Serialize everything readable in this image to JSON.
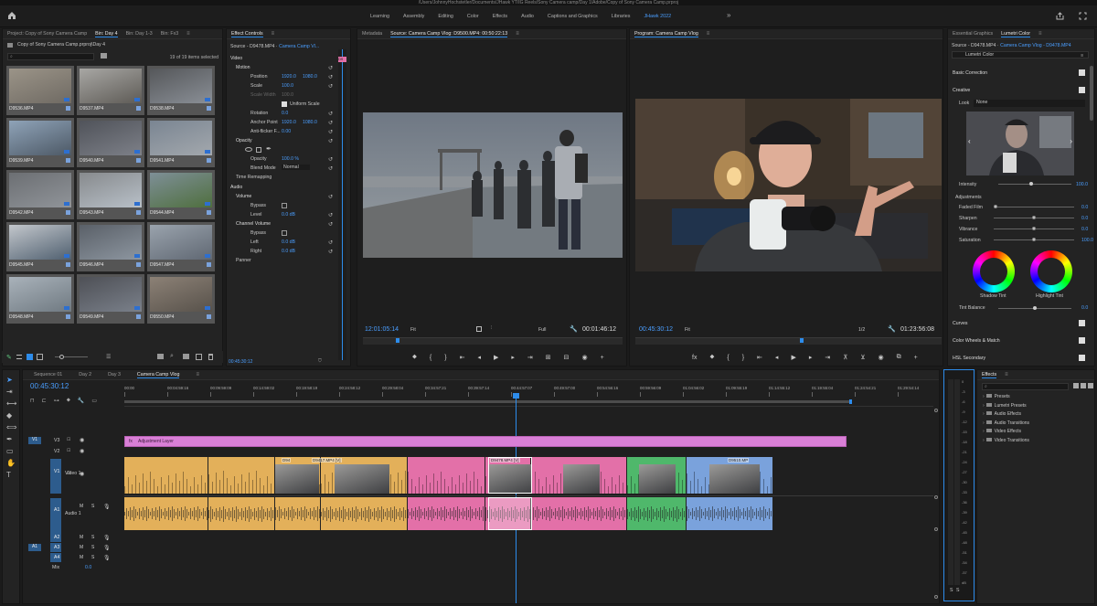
{
  "title_bar": {
    "path": "/Users/JohnnyHochstetler/Documents/JHawk YT/IG Reels/Sony Camera camp/Day 1/Adobe/Copy of Sony Camera Camp.prproj"
  },
  "workspaces": {
    "items": [
      "Learning",
      "Assembly",
      "Editing",
      "Color",
      "Effects",
      "Audio",
      "Captions and Graphics",
      "Libraries",
      "JHawk 2022"
    ],
    "active": "JHawk 2022"
  },
  "project": {
    "tabs": [
      "Project: Copy of Sony Camera Camp",
      "Bin: Day 4",
      "Bin: Day 1-3",
      "Bin: Fx3"
    ],
    "breadcrumb": "Copy of Sony Camera Camp.prproj\\Day 4",
    "selection": "19 of 19 items selected",
    "clips": [
      "D9536.MP4",
      "D9537.MP4",
      "D9538.MP4",
      "D9539.MP4",
      "D9540.MP4",
      "D9541.MP4",
      "D9542.MP4",
      "D9543.MP4",
      "D9544.MP4",
      "D9545.MP4",
      "D9546.MP4",
      "D9547.MP4",
      "D9548.MP4",
      "D9549.MP4",
      "D9550.MP4"
    ]
  },
  "effect_controls": {
    "tab": "Effect Controls",
    "source": "Source - D9478.MP4",
    "seq": "Camera Camp Vl...",
    "timecode": "00:45:30:12",
    "video": "Video",
    "motion": "Motion",
    "position": "Position",
    "pos_x": "1920.0",
    "pos_y": "1080.0",
    "scale": "Scale",
    "scale_v": "100.0",
    "scale_width": "Scale Width",
    "scale_width_v": "100.0",
    "uniform": "Uniform Scale",
    "rotation": "Rotation",
    "rotation_v": "0.0",
    "anchor": "Anchor Point",
    "anc_x": "1920.0",
    "anc_y": "1080.0",
    "flicker": "Anti-flicker F...",
    "flicker_v": "0.00",
    "opacity": "Opacity",
    "opacity_p": "Opacity",
    "opacity_v": "100.0 %",
    "blend": "Blend Mode",
    "blend_v": "Normal",
    "remap": "Time Remapping",
    "audio": "Audio",
    "volume": "Volume",
    "bypass": "Bypass",
    "level": "Level",
    "level_v": "0.0 dB",
    "channel": "Channel Volume",
    "bypass2": "Bypass",
    "left": "Left",
    "left_v": "0.0 dB",
    "right": "Right",
    "right_v": "0.0 dB",
    "panner": "Panner"
  },
  "source": {
    "tabs": [
      "Metadata",
      "Source: Camera Camp Vlog: D9500.MP4: 00:50:22:13"
    ],
    "tc": "12:01:05:14",
    "fit": "Fit",
    "quality": "Full",
    "dur": "00:01:46:12"
  },
  "program": {
    "tab": "Program: Camera Camp Vlog",
    "tc": "00:45:30:12",
    "fit": "Fit",
    "ratio": "1/2",
    "dur": "01:23:56:08"
  },
  "lumetri": {
    "tabs": [
      "Essential Graphics",
      "Lumetri Color"
    ],
    "source": "Source - D9478.MP4",
    "seq": "Camera Camp Vlog - D9478.MP4",
    "effect": "Lumetri Color",
    "basic": "Basic Correction",
    "creative": "Creative",
    "look": "Look",
    "look_v": "None",
    "intensity": "Intensity",
    "intensity_v": "100.0",
    "adjust": "Adjustments",
    "faded": "Faded Film",
    "faded_v": "0.0",
    "sharpen": "Sharpen",
    "sharpen_v": "0.0",
    "vibrance": "Vibrance",
    "vibrance_v": "0.0",
    "saturation": "Saturation",
    "saturation_v": "100.0",
    "shadow": "Shadow Tint",
    "highlight": "Highlight Tint",
    "balance": "Tint Balance",
    "balance_v": "0.0",
    "curves": "Curves",
    "wheels": "Color Wheels & Match",
    "hsl": "HSL Secondary"
  },
  "timeline": {
    "tabs": [
      "Sequence 01",
      "Day 2",
      "Day 3",
      "Camera Camp Vlog"
    ],
    "tc": "00:45:30:12",
    "ruler": [
      "00:00",
      "00:04:59:16",
      "00:09:59:09",
      "00:14:59:02",
      "00:19:58:19",
      "00:24:58:12",
      "00:29:58:04",
      "00:34:57:21",
      "00:39:57:14",
      "00:44:57:07",
      "00:49:57:00",
      "00:54:56:16",
      "00:59:56:09",
      "01:04:56:02",
      "01:09:55:19",
      "01:14:55:12",
      "01:19:55:04",
      "01:24:54:21",
      "01:29:54:14"
    ],
    "tracks": {
      "v3": "V3",
      "v2": "V2",
      "v1": "V1",
      "v1name": "Video 1",
      "a1": "A1",
      "a1name": "Audio 1",
      "a2": "A2",
      "a3": "A3",
      "a4": "A4",
      "mix": "Mix",
      "mix_v": "0.0",
      "src_v": "V1",
      "src_a": "A1"
    },
    "adjustment": "Adjustment Layer",
    "clip_labels": [
      "D94",
      "D9417.MP4 [V]",
      "D9478.MP4 [V]",
      "D9510.MP"
    ]
  },
  "effects": {
    "tab": "Effects",
    "items": [
      "Presets",
      "Lumetri Presets",
      "Audio Effects",
      "Audio Transitions",
      "Video Effects",
      "Video Transitions"
    ]
  },
  "meter": {
    "ticks": [
      "0",
      "-3",
      "-6",
      "-9",
      "-12",
      "-15",
      "-18",
      "-21",
      "-24",
      "-27",
      "-30",
      "-33",
      "-36",
      "-39",
      "-42",
      "-45",
      "-48",
      "-51",
      "-54",
      "-57",
      "dB"
    ],
    "solo": "S",
    "solo2": "S"
  },
  "colors": {
    "accent": "#2d8ceb",
    "audio_green": "#5ec47d",
    "adjustment": "#d97fd6",
    "clip_yellow": "#e3b05a",
    "clip_pink": "#e370a8",
    "clip_green": "#4fb86b",
    "clip_blue": "#7aa2dc"
  }
}
